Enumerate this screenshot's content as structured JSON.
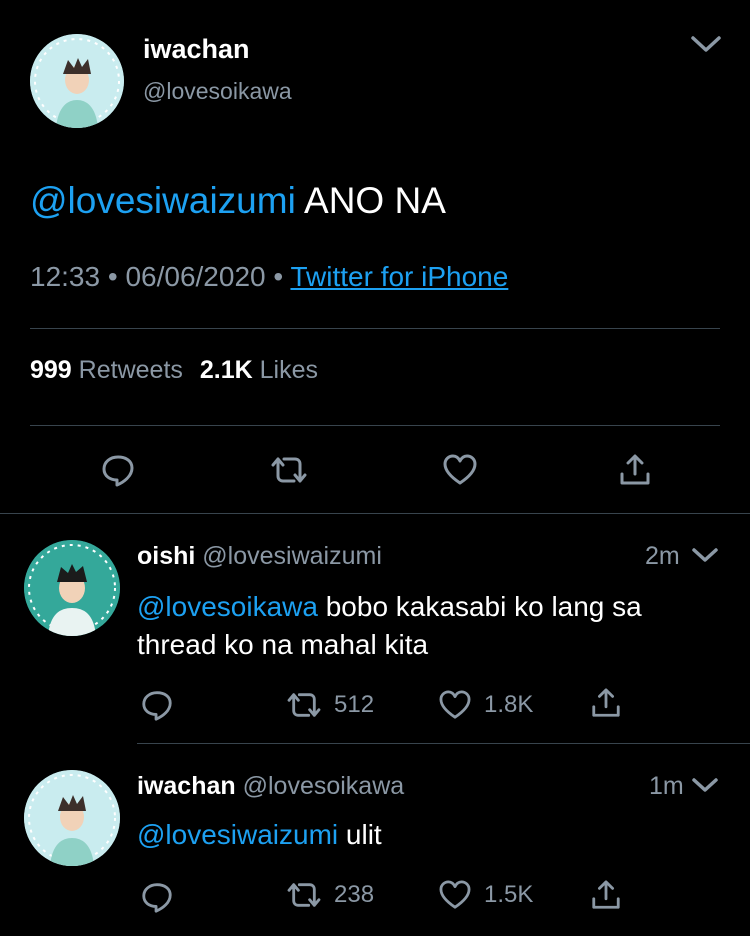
{
  "main_tweet": {
    "display_name": "iwachan",
    "handle": "@lovesoikawa",
    "mention": "@lovesiwaizumi",
    "text": " ANO NA",
    "time": "12:33",
    "date": "06/06/2020",
    "source": "Twitter for iPhone",
    "retweets_count": "999",
    "retweets_label": "Retweets",
    "likes_count": "2.1K",
    "likes_label": "Likes"
  },
  "replies": [
    {
      "display_name": "oishi",
      "handle": "@lovesiwaizumi",
      "age": "2m",
      "mention": "@lovesoikawa",
      "text_line1": " bobo kakasabi ko lang sa",
      "text_line2": "thread ko na mahal kita",
      "retweets": "512",
      "likes": "1.8K"
    },
    {
      "display_name": "iwachan",
      "handle": "@lovesoikawa",
      "age": "1m",
      "mention": "@lovesiwaizumi",
      "text": " ulit",
      "retweets": "238",
      "likes": "1.5K"
    }
  ],
  "icons": [
    "chevron-down-icon",
    "reply-icon",
    "retweet-icon",
    "like-icon",
    "share-icon"
  ]
}
